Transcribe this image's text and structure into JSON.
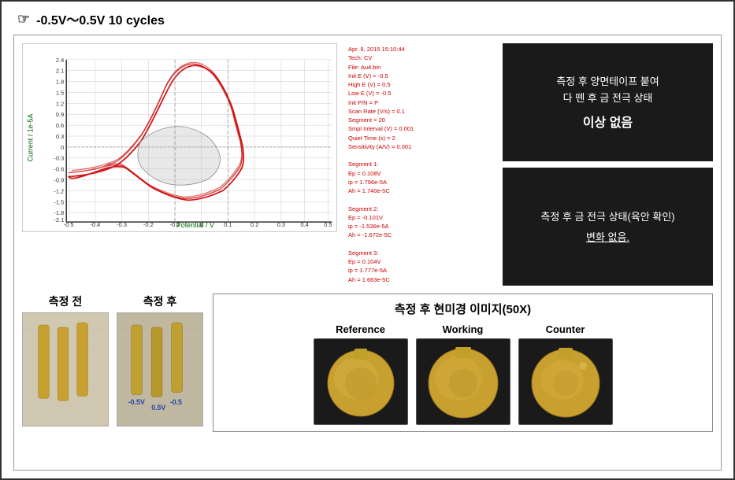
{
  "header": {
    "arrow": "☞",
    "title": "-0.5V～0.5V  10  cycles"
  },
  "chart": {
    "y_label": "Current / 1e-5A",
    "x_label": "Potential / V",
    "y_ticks": [
      "2.4",
      "2.1",
      "1.8",
      "1.5",
      "1.2",
      "0.9",
      "0.6",
      "0.3",
      "0",
      "-0.3",
      "-0.6",
      "-0.9",
      "-1.2",
      "-1.5",
      "-1.8",
      "-2.1"
    ],
    "x_ticks": [
      "-0.5",
      "-0.4",
      "-0.3",
      "-0.2",
      "-0.1",
      "0",
      "0.1",
      "0.2",
      "0.3",
      "0.4",
      "0.5"
    ]
  },
  "chart_info": {
    "lines": [
      "Apr. 9, 2015  15:10:44",
      "Tech: CV",
      "File: Au4.bin",
      "Init E (V) = -0.5",
      "High E (V) = 0.5",
      "Low E (V) = -0.5",
      "Init P/N = P",
      "Scan Rate (V/s) = 0.1",
      "Segment = 20",
      "Smpl Interval (V) = 0.001",
      "Quiet Time (s) = 2",
      "Sensitivity (A/V) = 0.001",
      "",
      "Segment 1:",
      "Ep = 0.108V",
      "ip = 1.796e-5A",
      "Ah = 1.740e-5C",
      "",
      "Segment 2:",
      "Ep = -0.101V",
      "ip = -1.536e-5A",
      "Ah = -1.672e-5C",
      "",
      "Segment 3:",
      "Ep = 0.104V",
      "ip = 1.777e-5A",
      "Ah = 1.663e-5C"
    ]
  },
  "right_panel_1": {
    "line1": "측정 후 양면테이프 붙여",
    "line2": "다 뗀 후 금 전극 상태",
    "highlight": "이상 없음"
  },
  "right_panel_2": {
    "line1": "측정 후 금 전극 상태(육안 확인)",
    "highlight": "변화 없음."
  },
  "bottom": {
    "before_label": "측정 전",
    "after_label": "측정 후",
    "microscope_title": "측정 후 현미경 이미지(50X)",
    "micro_labels": [
      "Reference",
      "Working",
      "Counter"
    ]
  }
}
